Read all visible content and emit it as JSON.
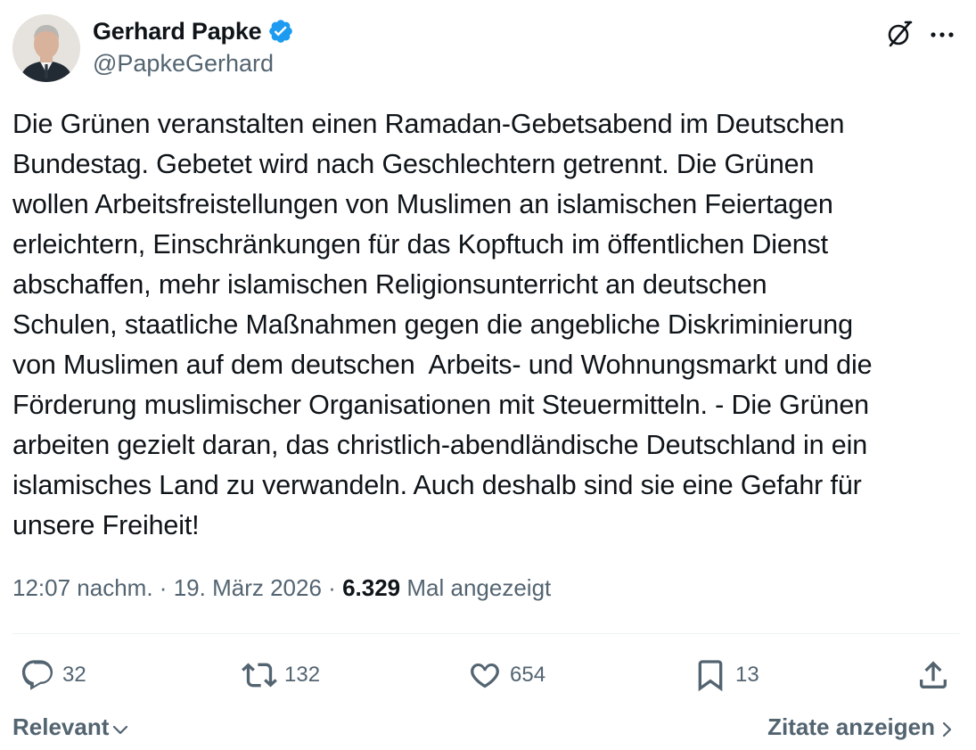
{
  "author": {
    "display_name": "Gerhard Papke",
    "handle": "@PapkeGerhard",
    "verified": true
  },
  "post": {
    "text": "Die Grünen veranstalten einen Ramadan-Gebetsabend im Deutschen\nBundestag. Gebetet wird nach Geschlechtern getrennt. Die Grünen\nwollen Arbeitsfreistellungen von Muslimen an islamischen Feiertagen\nerleichtern, Einschränkungen für das Kopftuch im öffentlichen Dienst\nabschaffen, mehr islamischen Religionsunterricht an deutschen\nSchulen, staatliche Maßnahmen gegen die angebliche Diskriminierung\nvon Muslimen auf dem deutschen  Arbeits- und Wohnungsmarkt und die\nFörderung muslimischer Organisationen mit Steuermitteln. - Die Grünen\narbeiten gezielt daran, das christlich-abendländische Deutschland in ein\nislamisches Land zu verwandeln. Auch deshalb sind sie eine Gefahr für\nunsere Freiheit!",
    "time": "12:07 nachm.",
    "separator": "·",
    "date": "19. März 2026",
    "views_count": "6.329",
    "views_label": "Mal angezeigt"
  },
  "actions": {
    "replies": "32",
    "reposts": "132",
    "likes": "654",
    "bookmarks": "13"
  },
  "footer": {
    "sort_label": "Relevant",
    "quotes_label": "Zitate anzeigen"
  },
  "icons": {
    "verified": "verified-badge-icon",
    "grok": "grok-icon",
    "more": "more-dots-icon",
    "reply": "reply-icon",
    "retweet": "retweet-icon",
    "like": "heart-icon",
    "bookmark": "bookmark-icon",
    "share": "share-icon"
  },
  "colors": {
    "text_primary": "#0f1419",
    "text_secondary": "#536471",
    "verified_blue": "#1d9bf0",
    "divider": "#eff3f4"
  }
}
